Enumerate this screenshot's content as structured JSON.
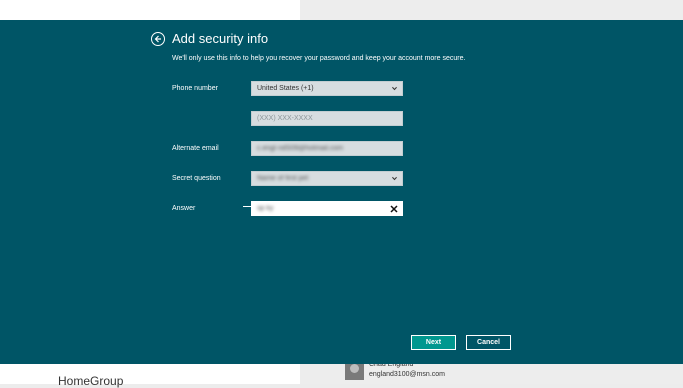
{
  "background": {
    "homegroup_label": "HomeGroup",
    "user_name": "Chad England",
    "user_email": "england3100@msn.com"
  },
  "dialog": {
    "title": "Add security info",
    "subtitle": "We'll only use this info to help you recover your password and keep your account more secure.",
    "phone_label": "Phone number",
    "country_value": "United States (+1)",
    "phone_placeholder": "(XXX) XXX-XXXX",
    "alt_email_label": "Alternate email",
    "alt_email_value": "c.engl·ndS09@hotmail.com",
    "secret_question_label": "Secret question",
    "secret_question_value": "Name of first pet",
    "answer_label": "Answer",
    "answer_value": "sp ky",
    "next_label": "Next",
    "cancel_label": "Cancel"
  },
  "colors": {
    "dialog_bg": "#005566",
    "next_button": "#00978f"
  }
}
